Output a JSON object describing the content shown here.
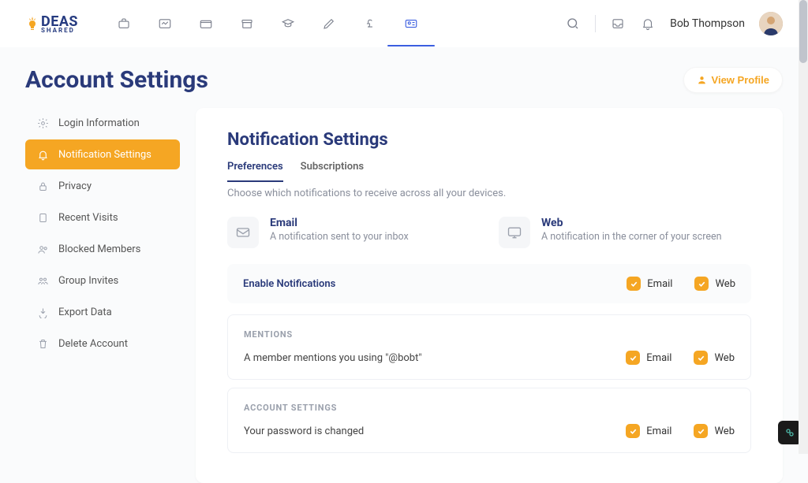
{
  "logo": {
    "brand": "DEAS",
    "sub": "SHARED"
  },
  "header": {
    "username": "Bob Thompson"
  },
  "page": {
    "title": "Account Settings",
    "view_profile": "View Profile"
  },
  "sidebar": {
    "items": [
      {
        "label": "Login Information"
      },
      {
        "label": "Notification Settings"
      },
      {
        "label": "Privacy"
      },
      {
        "label": "Recent Visits"
      },
      {
        "label": "Blocked Members"
      },
      {
        "label": "Group Invites"
      },
      {
        "label": "Export Data"
      },
      {
        "label": "Delete Account"
      }
    ]
  },
  "main": {
    "title": "Notification Settings",
    "tabs": [
      {
        "label": "Preferences"
      },
      {
        "label": "Subscriptions"
      }
    ],
    "desc": "Choose which notifications to receive across all your devices.",
    "channels": [
      {
        "title": "Email",
        "desc": "A notification sent to your inbox"
      },
      {
        "title": "Web",
        "desc": "A notification in the corner of your screen"
      }
    ],
    "enable_label": "Enable Notifications",
    "check_email": "Email",
    "check_web": "Web",
    "cards": [
      {
        "head": "MENTIONS",
        "row": "A member mentions you using \"@bobt\""
      },
      {
        "head": "ACCOUNT SETTINGS",
        "row": "Your password is changed"
      }
    ]
  }
}
